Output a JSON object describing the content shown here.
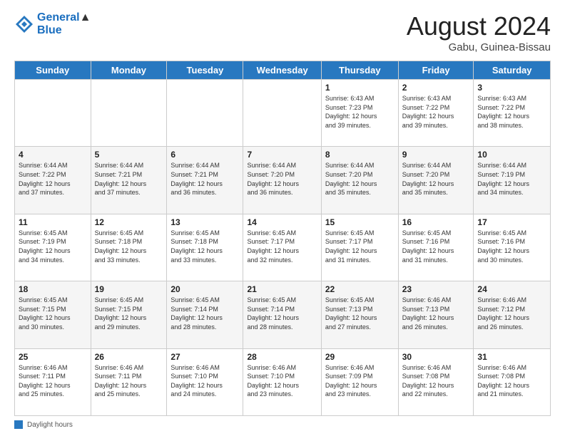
{
  "logo": {
    "line1": "General",
    "line2": "Blue"
  },
  "title": "August 2024",
  "location": "Gabu, Guinea-Bissau",
  "days_header": [
    "Sunday",
    "Monday",
    "Tuesday",
    "Wednesday",
    "Thursday",
    "Friday",
    "Saturday"
  ],
  "footer_label": "Daylight hours",
  "weeks": [
    [
      {
        "num": "",
        "info": ""
      },
      {
        "num": "",
        "info": ""
      },
      {
        "num": "",
        "info": ""
      },
      {
        "num": "",
        "info": ""
      },
      {
        "num": "1",
        "info": "Sunrise: 6:43 AM\nSunset: 7:23 PM\nDaylight: 12 hours\nand 39 minutes."
      },
      {
        "num": "2",
        "info": "Sunrise: 6:43 AM\nSunset: 7:22 PM\nDaylight: 12 hours\nand 39 minutes."
      },
      {
        "num": "3",
        "info": "Sunrise: 6:43 AM\nSunset: 7:22 PM\nDaylight: 12 hours\nand 38 minutes."
      }
    ],
    [
      {
        "num": "4",
        "info": "Sunrise: 6:44 AM\nSunset: 7:22 PM\nDaylight: 12 hours\nand 37 minutes."
      },
      {
        "num": "5",
        "info": "Sunrise: 6:44 AM\nSunset: 7:21 PM\nDaylight: 12 hours\nand 37 minutes."
      },
      {
        "num": "6",
        "info": "Sunrise: 6:44 AM\nSunset: 7:21 PM\nDaylight: 12 hours\nand 36 minutes."
      },
      {
        "num": "7",
        "info": "Sunrise: 6:44 AM\nSunset: 7:20 PM\nDaylight: 12 hours\nand 36 minutes."
      },
      {
        "num": "8",
        "info": "Sunrise: 6:44 AM\nSunset: 7:20 PM\nDaylight: 12 hours\nand 35 minutes."
      },
      {
        "num": "9",
        "info": "Sunrise: 6:44 AM\nSunset: 7:20 PM\nDaylight: 12 hours\nand 35 minutes."
      },
      {
        "num": "10",
        "info": "Sunrise: 6:44 AM\nSunset: 7:19 PM\nDaylight: 12 hours\nand 34 minutes."
      }
    ],
    [
      {
        "num": "11",
        "info": "Sunrise: 6:45 AM\nSunset: 7:19 PM\nDaylight: 12 hours\nand 34 minutes."
      },
      {
        "num": "12",
        "info": "Sunrise: 6:45 AM\nSunset: 7:18 PM\nDaylight: 12 hours\nand 33 minutes."
      },
      {
        "num": "13",
        "info": "Sunrise: 6:45 AM\nSunset: 7:18 PM\nDaylight: 12 hours\nand 33 minutes."
      },
      {
        "num": "14",
        "info": "Sunrise: 6:45 AM\nSunset: 7:17 PM\nDaylight: 12 hours\nand 32 minutes."
      },
      {
        "num": "15",
        "info": "Sunrise: 6:45 AM\nSunset: 7:17 PM\nDaylight: 12 hours\nand 31 minutes."
      },
      {
        "num": "16",
        "info": "Sunrise: 6:45 AM\nSunset: 7:16 PM\nDaylight: 12 hours\nand 31 minutes."
      },
      {
        "num": "17",
        "info": "Sunrise: 6:45 AM\nSunset: 7:16 PM\nDaylight: 12 hours\nand 30 minutes."
      }
    ],
    [
      {
        "num": "18",
        "info": "Sunrise: 6:45 AM\nSunset: 7:15 PM\nDaylight: 12 hours\nand 30 minutes."
      },
      {
        "num": "19",
        "info": "Sunrise: 6:45 AM\nSunset: 7:15 PM\nDaylight: 12 hours\nand 29 minutes."
      },
      {
        "num": "20",
        "info": "Sunrise: 6:45 AM\nSunset: 7:14 PM\nDaylight: 12 hours\nand 28 minutes."
      },
      {
        "num": "21",
        "info": "Sunrise: 6:45 AM\nSunset: 7:14 PM\nDaylight: 12 hours\nand 28 minutes."
      },
      {
        "num": "22",
        "info": "Sunrise: 6:45 AM\nSunset: 7:13 PM\nDaylight: 12 hours\nand 27 minutes."
      },
      {
        "num": "23",
        "info": "Sunrise: 6:46 AM\nSunset: 7:13 PM\nDaylight: 12 hours\nand 26 minutes."
      },
      {
        "num": "24",
        "info": "Sunrise: 6:46 AM\nSunset: 7:12 PM\nDaylight: 12 hours\nand 26 minutes."
      }
    ],
    [
      {
        "num": "25",
        "info": "Sunrise: 6:46 AM\nSunset: 7:11 PM\nDaylight: 12 hours\nand 25 minutes."
      },
      {
        "num": "26",
        "info": "Sunrise: 6:46 AM\nSunset: 7:11 PM\nDaylight: 12 hours\nand 25 minutes."
      },
      {
        "num": "27",
        "info": "Sunrise: 6:46 AM\nSunset: 7:10 PM\nDaylight: 12 hours\nand 24 minutes."
      },
      {
        "num": "28",
        "info": "Sunrise: 6:46 AM\nSunset: 7:10 PM\nDaylight: 12 hours\nand 23 minutes."
      },
      {
        "num": "29",
        "info": "Sunrise: 6:46 AM\nSunset: 7:09 PM\nDaylight: 12 hours\nand 23 minutes."
      },
      {
        "num": "30",
        "info": "Sunrise: 6:46 AM\nSunset: 7:08 PM\nDaylight: 12 hours\nand 22 minutes."
      },
      {
        "num": "31",
        "info": "Sunrise: 6:46 AM\nSunset: 7:08 PM\nDaylight: 12 hours\nand 21 minutes."
      }
    ]
  ]
}
